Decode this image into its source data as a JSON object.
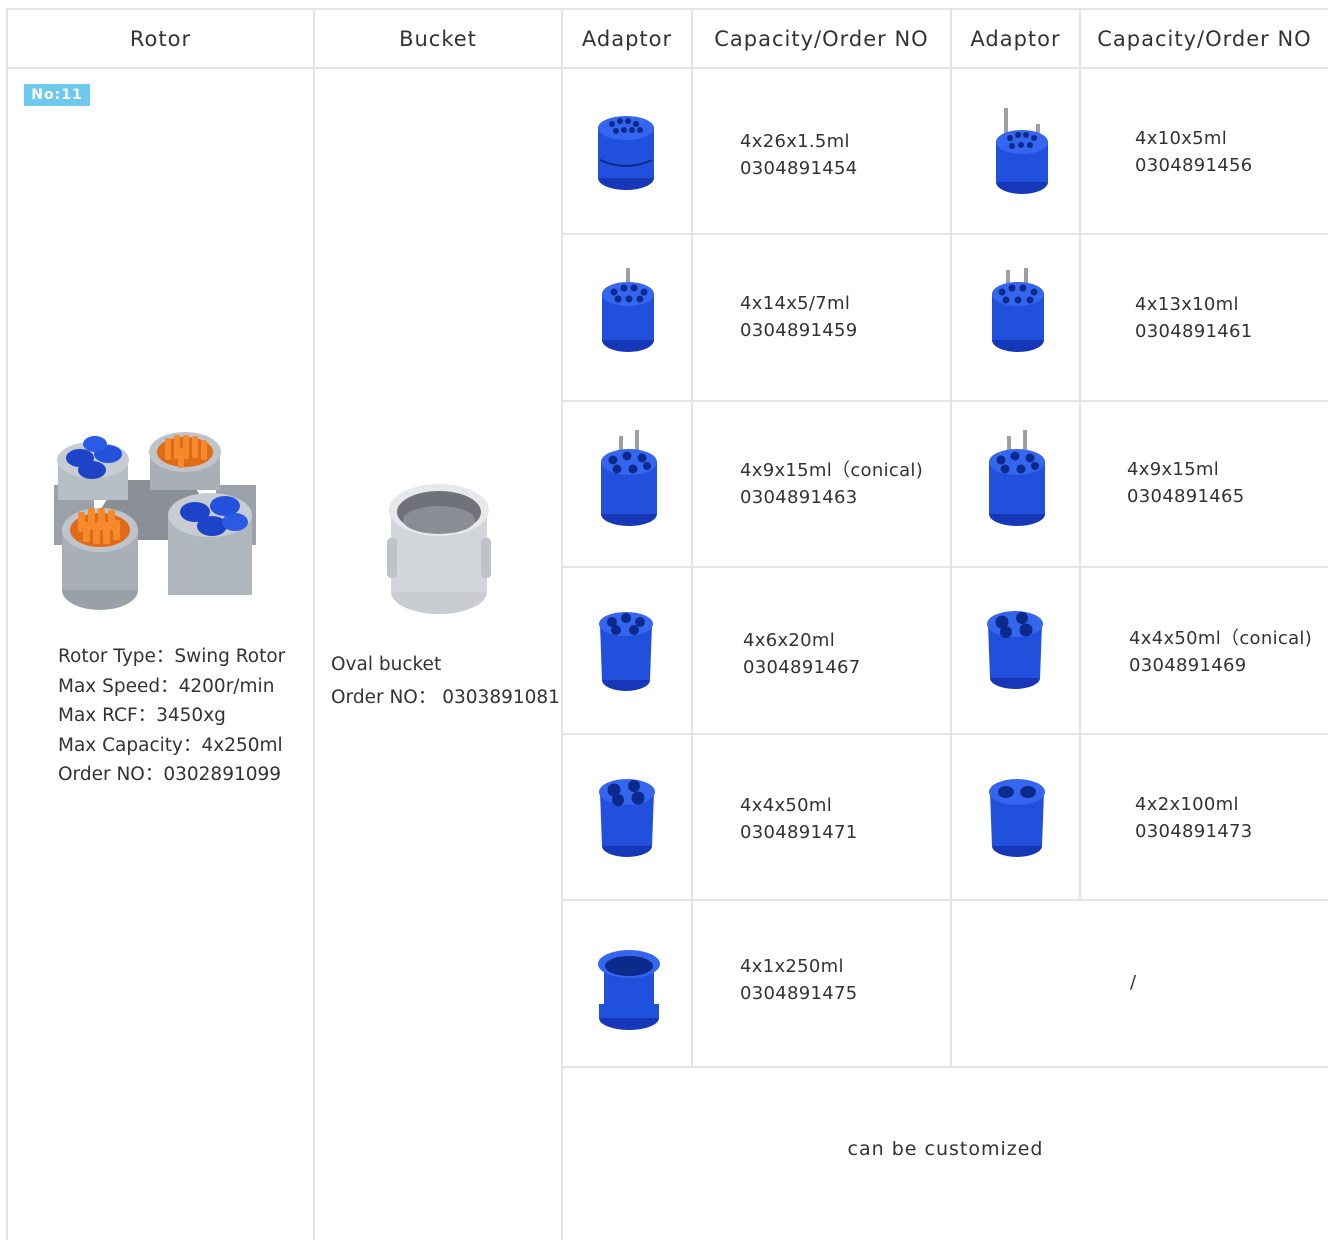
{
  "headers": [
    "Rotor",
    "Bucket",
    "Adaptor",
    "Capacity/Order NO",
    "Adaptor",
    "Capacity/Order NO"
  ],
  "rotor": {
    "badge": "No:11",
    "specs": [
      "Rotor Type：Swing Rotor",
      "Max Speed：4200r/min",
      "Max RCF：3450xg",
      "Max Capacity：4x250ml",
      "Order NO：0302891099"
    ],
    "image_icon": "swing-rotor-image"
  },
  "bucket": {
    "name": "Oval bucket",
    "order": "Order NO：  0303891081",
    "image_icon": "oval-bucket-image"
  },
  "adaptors_left": [
    {
      "capacity": "4x26x1.5ml",
      "order": "0304891454"
    },
    {
      "capacity": "4x14x5/7ml",
      "order": "0304891459"
    },
    {
      "capacity": "4x9x15ml（conical)",
      "order": "0304891463"
    },
    {
      "capacity": "4x6x20ml",
      "order": "0304891467"
    },
    {
      "capacity": "4x4x50ml",
      "order": "0304891471"
    },
    {
      "capacity": "4x1x250ml",
      "order": "0304891475"
    }
  ],
  "adaptors_right": [
    {
      "capacity": "4x10x5ml",
      "order": "0304891456"
    },
    {
      "capacity": "4x13x10ml",
      "order": "0304891461"
    },
    {
      "capacity": "4x9x15ml",
      "order": "0304891465"
    },
    {
      "capacity": "4x4x50ml（conical)",
      "order": "0304891469"
    },
    {
      "capacity": "4x2x100ml",
      "order": "0304891473"
    }
  ],
  "empty_cell": "/",
  "footer_note": "can be customized",
  "colors": {
    "adaptor_blue": "#1f4fe0",
    "grid": "#e4e4e4",
    "badge": "#6fc8ee",
    "tube_orange": "#f07a1a"
  }
}
